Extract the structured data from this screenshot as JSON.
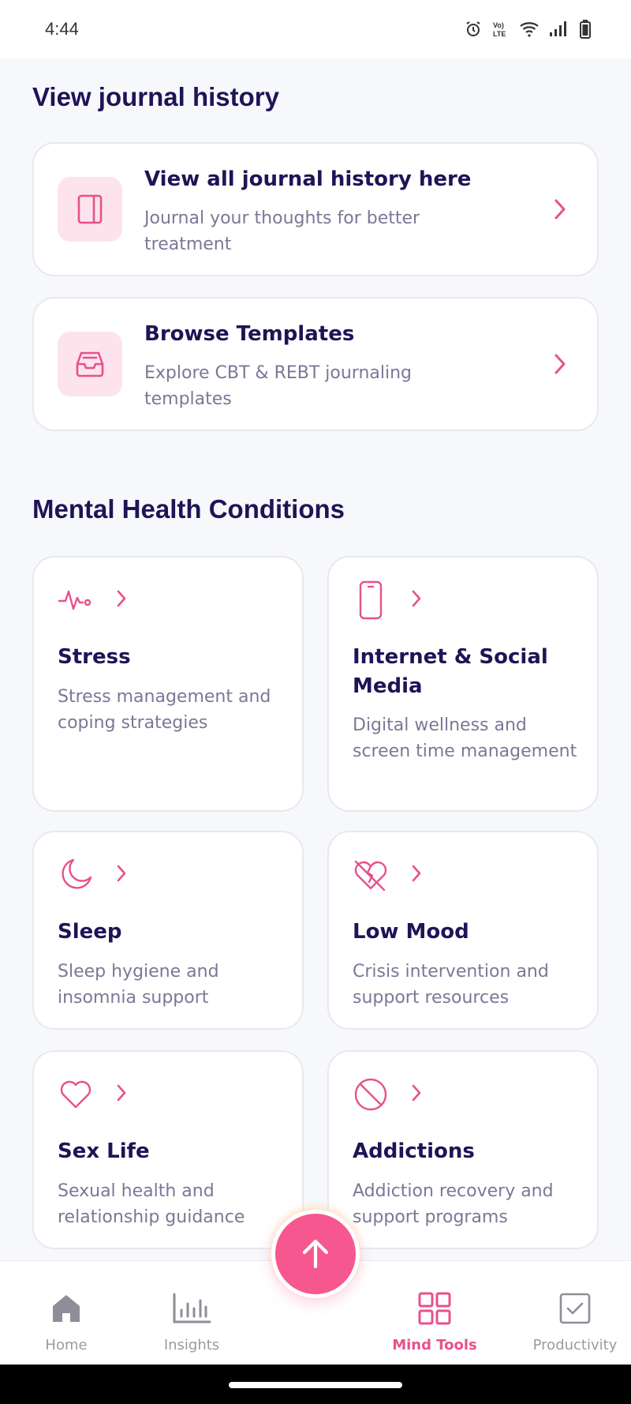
{
  "status_bar": {
    "time": "4:44",
    "icons": [
      "alarm-icon",
      "volte-icon",
      "wifi-icon",
      "signal-icon",
      "battery-icon"
    ]
  },
  "journal_section": {
    "title": "View journal history",
    "cards": [
      {
        "title": "View all journal history here",
        "subtitle": "Journal your thoughts for better treatment",
        "icon": "journal-book-icon"
      },
      {
        "title": "Browse Templates",
        "subtitle": "Explore CBT & REBT journaling templates",
        "icon": "inbox-tray-icon"
      }
    ]
  },
  "conditions_section": {
    "title": "Mental Health Conditions",
    "items": [
      {
        "title": "Stress",
        "description": "Stress management and coping strategies",
        "icon": "heartbeat-icon"
      },
      {
        "title": "Internet & Social Media",
        "description": "Digital wellness and screen time management",
        "icon": "smartphone-icon"
      },
      {
        "title": "Sleep",
        "description": "Sleep hygiene and insomnia support",
        "icon": "moon-icon"
      },
      {
        "title": "Low Mood",
        "description": "Crisis intervention and support resources",
        "icon": "broken-heart-icon"
      },
      {
        "title": "Sex Life",
        "description": "Sexual health and relationship guidance",
        "icon": "heart-icon"
      },
      {
        "title": "Addictions",
        "description": "Addiction recovery and support programs",
        "icon": "prohibited-icon"
      }
    ]
  },
  "bottom_nav": {
    "items": [
      {
        "label": "Home",
        "icon": "home-icon",
        "active": false
      },
      {
        "label": "Insights",
        "icon": "bar-chart-icon",
        "active": false
      },
      {
        "label": "Mind Tools",
        "icon": "grid-icon",
        "active": true
      },
      {
        "label": "Productivity",
        "icon": "checkbox-icon",
        "active": false
      }
    ],
    "fab_icon": "arrow-up-icon"
  },
  "colors": {
    "accent": "#e8508c",
    "fab": "#f7578f",
    "heading": "#1e1456",
    "muted": "#7a7896",
    "icon_bg": "#fde4ec"
  }
}
